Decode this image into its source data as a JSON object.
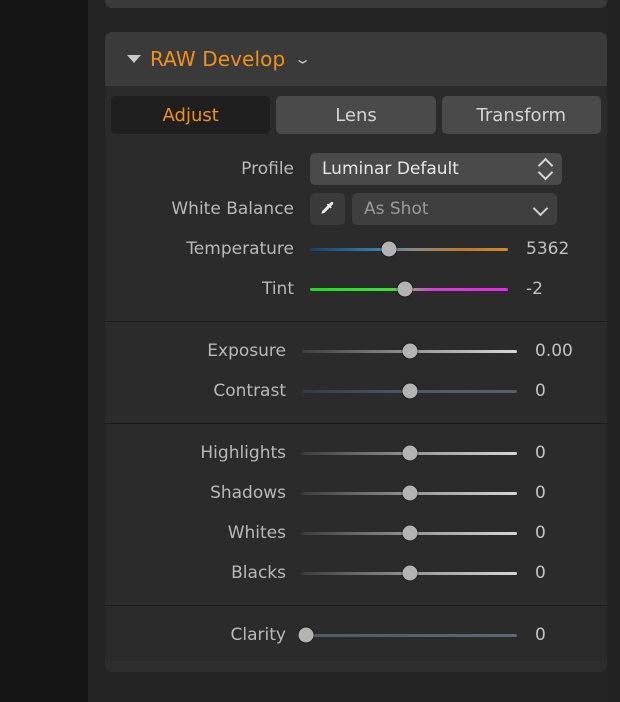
{
  "window": {
    "scrollbar": {
      "name": "vertical-scrollbar"
    },
    "background_color": "#141414",
    "panel_color": "#232323"
  },
  "panel": {
    "header": {
      "title": "RAW Develop",
      "title_color": "#f0911e",
      "collapse_triangle": "triangle-down-icon",
      "chevron": "chevron-down-icon"
    },
    "tabs": [
      {
        "label": "Adjust",
        "active": true
      },
      {
        "label": "Lens",
        "active": false
      },
      {
        "label": "Transform",
        "active": false
      }
    ],
    "groups": [
      {
        "name": "profile-white-balance",
        "rows": [
          {
            "type": "select",
            "label": "Profile",
            "value": "Luminar Default",
            "control_icon": "chevron-up-down-icon"
          },
          {
            "type": "select-with-picker",
            "label": "White Balance",
            "value": "As Shot",
            "picker_icon": "eyedropper-icon",
            "control_icon": "chevron-down-icon"
          },
          {
            "type": "slider",
            "label": "Temperature",
            "value": "5362",
            "knob_percent": 40,
            "track": "temperature-gradient",
            "wide": true
          },
          {
            "type": "slider",
            "label": "Tint",
            "value": "-2",
            "knob_percent": 48,
            "track": "tint-gradient",
            "wide": true
          }
        ]
      },
      {
        "name": "exposure-contrast",
        "rows": [
          {
            "type": "slider",
            "label": "Exposure",
            "value": "0.00",
            "knob_percent": 50,
            "track": "neutral-gradient",
            "wide": false
          },
          {
            "type": "slider",
            "label": "Contrast",
            "value": "0",
            "knob_percent": 50,
            "track": "blue-gradient",
            "wide": false
          }
        ]
      },
      {
        "name": "tonal-range",
        "rows": [
          {
            "type": "slider",
            "label": "Highlights",
            "value": "0",
            "knob_percent": 50,
            "track": "neutral-gradient",
            "wide": false
          },
          {
            "type": "slider",
            "label": "Shadows",
            "value": "0",
            "knob_percent": 50,
            "track": "neutral-gradient",
            "wide": false
          },
          {
            "type": "slider",
            "label": "Whites",
            "value": "0",
            "knob_percent": 50,
            "track": "neutral-gradient",
            "wide": false
          },
          {
            "type": "slider",
            "label": "Blacks",
            "value": "0",
            "knob_percent": 50,
            "track": "neutral-gradient",
            "wide": false
          }
        ]
      },
      {
        "name": "clarity",
        "rows": [
          {
            "type": "slider",
            "label": "Clarity",
            "value": "0",
            "knob_percent": 2,
            "track": "clarity-gradient",
            "wide": false
          }
        ]
      }
    ]
  }
}
